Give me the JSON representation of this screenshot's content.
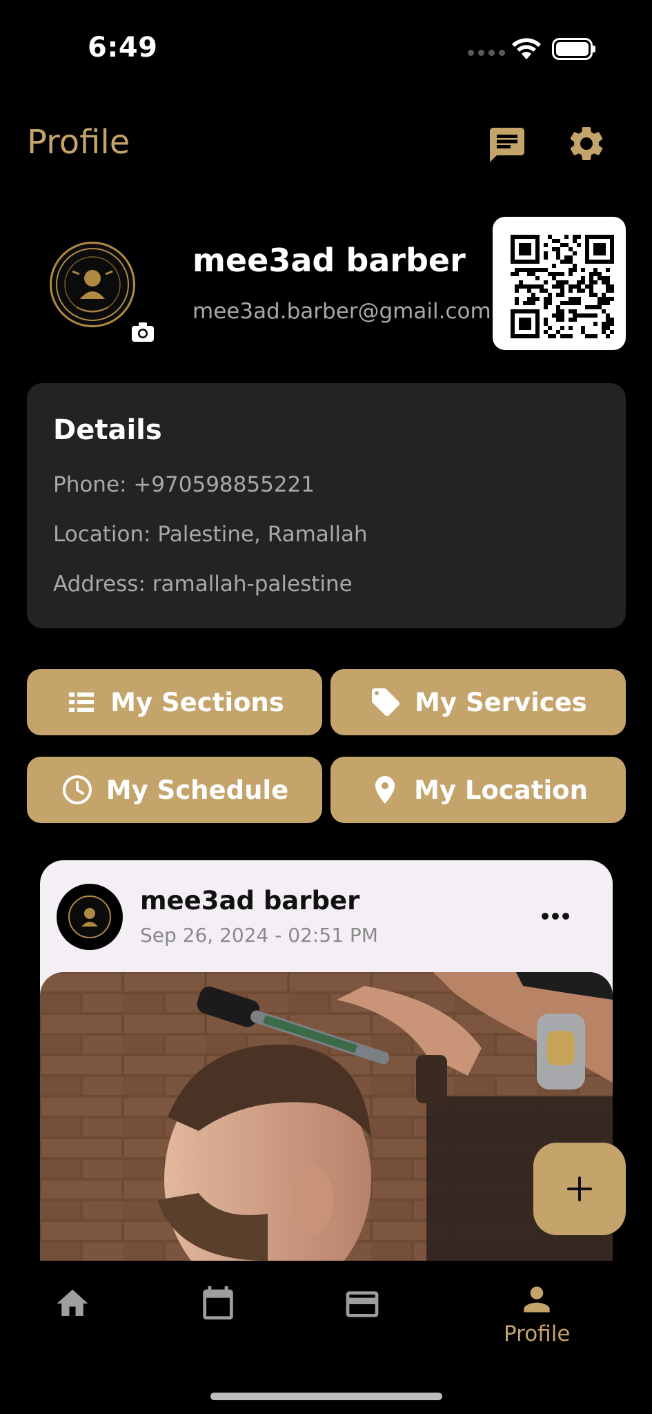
{
  "status_bar": {
    "time": "6:49"
  },
  "header": {
    "title": "Profile",
    "icons": [
      "chat-icon",
      "gear-icon"
    ]
  },
  "profile": {
    "name": "mee3ad barber",
    "email": "mee3ad.barber@gmail.com",
    "avatar_icon": "barbershop-logo",
    "camera_icon": "camera-icon",
    "qr_icon": "qr-code"
  },
  "details": {
    "title": "Details",
    "phone": "Phone: +970598855221",
    "location": "Location: Palestine, Ramallah",
    "address": "Address: ramallah-palestine"
  },
  "actions": [
    {
      "label": "My Sections",
      "icon": "list-icon"
    },
    {
      "label": "My Services",
      "icon": "tag-icon"
    },
    {
      "label": "My Schedule",
      "icon": "clock-icon"
    },
    {
      "label": "My Location",
      "icon": "location-pin-icon"
    }
  ],
  "post": {
    "author": "mee3ad barber",
    "date": "Sep 26, 2024 - 02:51 PM",
    "image": "barber cutting hair photo"
  },
  "fab": {
    "icon": "plus-icon"
  },
  "bottom_nav": {
    "items": [
      {
        "icon": "home-icon",
        "label": ""
      },
      {
        "icon": "calendar-icon",
        "label": ""
      },
      {
        "icon": "card-icon",
        "label": ""
      },
      {
        "icon": "person-icon",
        "label": "Profile"
      }
    ],
    "active_color": "#c4a46b",
    "inactive_color": "#9e9e9e"
  },
  "colors": {
    "accent": "#c4a46b",
    "background": "#000000",
    "card": "#232323"
  }
}
